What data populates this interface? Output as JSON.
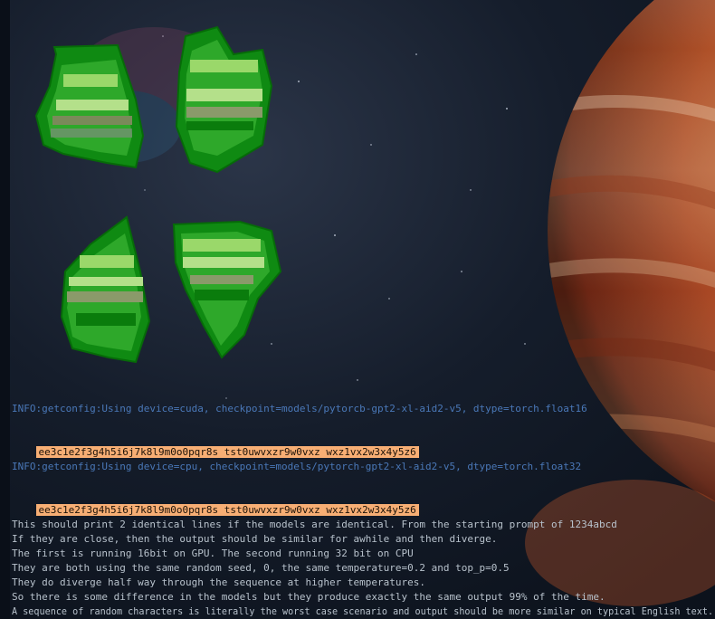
{
  "terminal": {
    "info_cuda": "INFO:getconfig:Using device=cuda, checkpoint=models/pytorcb-gpt2-xl-aid2-v5, dtype=torch.float16",
    "output_cuda": "ee3c1e2f3g4h5i6j7k8l9m0o0pqr8s tst0uwvxzr9w0vxz wxz1vx2w3x4y5z6",
    "info_cpu": "INFO:getconfig:Using device=cpu, checkpoint=models/pytorch-gpt2-xl-aid2-v5, dtype=torch.float32",
    "output_cpu": "ee3c1e2f3g4h5i6j7k8l9m0o0pqr8s tst0uwvxzr9w0vxz wxz1vx2w3x4y5z6",
    "lines": [
      "This should print 2 identical lines if the models are identical. From the starting prompt of 1234abcd",
      "If they are close, then the output should be similar for awhile and then diverge.",
      "The first is running 16bit on GPU. The second running 32 bit on CPU",
      "They are both using the same random seed, 0, the same temperature=0.2 and top_p=0.5",
      "They do diverge half way through the sequence at higher temperatures.",
      "So there is some difference in the models but they produce exactly the same output 99% of the time.",
      "A sequence of random characters is literally the worst case scenario and output should be more similar on typical English text."
    ]
  },
  "colors": {
    "info": "#4a78b8",
    "highlight": "#f7ae74",
    "text": "#b8c2cc",
    "leaf_dark": "#0f8a12",
    "leaf_mid": "#2ea82a",
    "leaf_light": "#9ad86a"
  }
}
